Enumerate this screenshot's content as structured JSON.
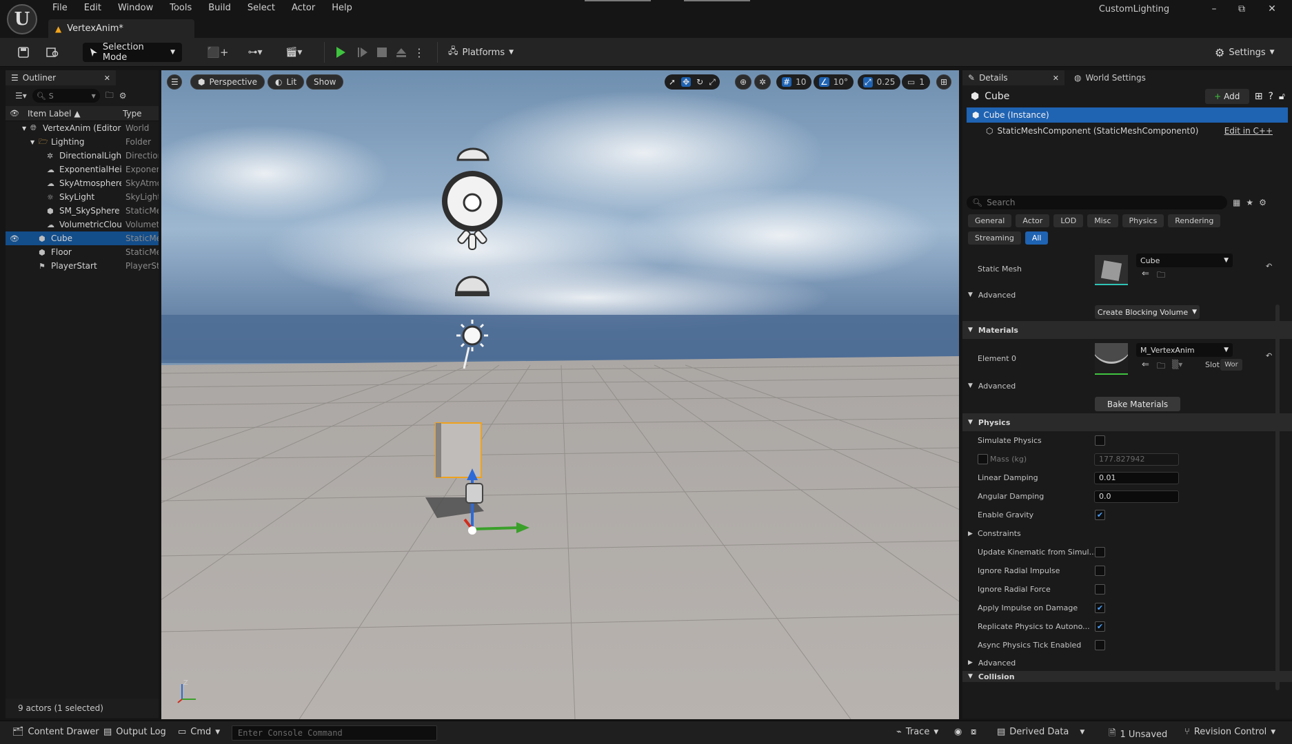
{
  "app": {
    "logo": "U",
    "project": "CustomLighting",
    "document_tab": "VertexAnim*",
    "menus": [
      "File",
      "Edit",
      "Window",
      "Tools",
      "Build",
      "Select",
      "Actor",
      "Help"
    ],
    "window_buttons": [
      "–",
      "⧉",
      "✕"
    ]
  },
  "toolbar": {
    "mode": "Selection Mode",
    "platforms": "Platforms",
    "settings": "Settings"
  },
  "outliner": {
    "title": "Outliner",
    "search_placeholder": "S",
    "col_label": "Item Label ▲",
    "col_type": "Type",
    "rows": [
      {
        "label": "VertexAnim (Editor)",
        "type": "World",
        "indent": 0
      },
      {
        "label": "Lighting",
        "type": "Folder",
        "indent": 1
      },
      {
        "label": "DirectionalLight",
        "type": "DirectionalLight",
        "indent": 2
      },
      {
        "label": "ExponentialHeightFog",
        "type": "ExponentialHeightFog",
        "indent": 2
      },
      {
        "label": "SkyAtmosphere",
        "type": "SkyAtmosphere",
        "indent": 2
      },
      {
        "label": "SkyLight",
        "type": "SkyLight",
        "indent": 2
      },
      {
        "label": "SM_SkySphere",
        "type": "StaticMeshActor",
        "indent": 2
      },
      {
        "label": "VolumetricCloud",
        "type": "VolumetricCloud",
        "indent": 2
      },
      {
        "label": "Cube",
        "type": "StaticMeshActor",
        "indent": 1
      },
      {
        "label": "Floor",
        "type": "StaticMeshActor",
        "indent": 1
      },
      {
        "label": "PlayerStart",
        "type": "PlayerStart",
        "indent": 1
      }
    ],
    "footer": "9 actors (1 selected)"
  },
  "viewport": {
    "hamburger": "☰",
    "perspective": "Perspective",
    "lit": "Lit",
    "show": "Show",
    "grid": "10",
    "angle": "10°",
    "scale": "0.25",
    "cam": "1"
  },
  "details": {
    "tab": "Details",
    "tab2": "World Settings",
    "actor": "Cube",
    "add": "Add",
    "instance": "Cube (Instance)",
    "component": "StaticMeshComponent (StaticMeshComponent0)",
    "edit_cpp": "Edit in C++",
    "search_placeholder": "Search",
    "filters": [
      "General",
      "Actor",
      "LOD",
      "Misc",
      "Physics",
      "Rendering"
    ],
    "filters2": [
      "Streaming",
      "All"
    ],
    "static_mesh_label": "Static Mesh",
    "static_mesh_value": "Cube",
    "advanced": "Advanced",
    "create_blocking": "Create Blocking Volume",
    "materials": "Materials",
    "element0": "Element 0",
    "material_value": "M_VertexAnim",
    "slot": "Slot",
    "slot_value": "Wor",
    "bake": "Bake Materials",
    "physics": "Physics",
    "physics_rows": [
      {
        "k": "Simulate Physics",
        "type": "cb",
        "v": false
      },
      {
        "k": "Mass (kg)",
        "type": "mass",
        "v": "177.827942"
      },
      {
        "k": "Linear Damping",
        "type": "num",
        "v": "0.01"
      },
      {
        "k": "Angular Damping",
        "type": "num",
        "v": "0.0"
      },
      {
        "k": "Enable Gravity",
        "type": "cb",
        "v": true
      },
      {
        "k": "Constraints",
        "type": "expand",
        "v": ""
      },
      {
        "k": "Update Kinematic from Simul...",
        "type": "cb",
        "v": false
      },
      {
        "k": "Ignore Radial Impulse",
        "type": "cb",
        "v": false
      },
      {
        "k": "Ignore Radial Force",
        "type": "cb",
        "v": false
      },
      {
        "k": "Apply Impulse on Damage",
        "type": "cb",
        "v": true
      },
      {
        "k": "Replicate Physics to Autono...",
        "type": "cb",
        "v": true
      },
      {
        "k": "Async Physics Tick Enabled",
        "type": "cb",
        "v": false
      }
    ],
    "advanced2": "Advanced",
    "collision": "Collision"
  },
  "status": {
    "content_drawer": "Content Drawer",
    "output_log": "Output Log",
    "cmd": "Cmd",
    "console_placeholder": "Enter Console Command",
    "trace": "Trace",
    "derived": "Derived Data",
    "unsaved": "1 Unsaved",
    "revision": "Revision Control"
  },
  "colors": {
    "accent": "#1f63b3",
    "play": "#3fc43f",
    "selection": "#134d8a"
  }
}
